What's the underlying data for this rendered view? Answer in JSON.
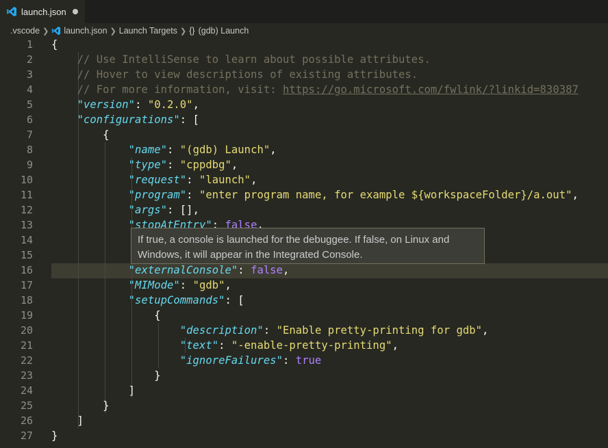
{
  "tab": {
    "label": "launch.json"
  },
  "breadcrumbs": {
    "items": [
      ".vscode",
      "launch.json",
      "Launch Targets",
      "(gdb) Launch"
    ],
    "braces": "{}"
  },
  "gutter": {
    "line_numbers": [
      "1",
      "2",
      "3",
      "4",
      "5",
      "6",
      "7",
      "8",
      "9",
      "10",
      "11",
      "12",
      "13",
      "14",
      "15",
      "16",
      "17",
      "18",
      "19",
      "20",
      "21",
      "22",
      "23",
      "24",
      "25",
      "26",
      "27"
    ]
  },
  "editor": {
    "current_line": 16,
    "lines": {
      "l1": "{",
      "l2": "// Use IntelliSense to learn about possible attributes.",
      "l3": "// Hover to view descriptions of existing attributes.",
      "l4_prefix": "// For more information, visit: ",
      "l4_link": "https://go.microsoft.com/fwlink/?linkid=830387",
      "l5_key": "\"version\"",
      "l5_val": "\"0.2.0\"",
      "l6_key": "\"configurations\"",
      "l6_rest": ": [",
      "l7": "{",
      "l8_key": "\"name\"",
      "l8_val": "\"(gdb) Launch\"",
      "l9_key": "\"type\"",
      "l9_val": "\"cppdbg\"",
      "l10_key": "\"request\"",
      "l10_val": "\"launch\"",
      "l11_key": "\"program\"",
      "l11_val": "\"enter program name, for example ${workspaceFolder}/a.out\"",
      "l12_key": "\"args\"",
      "l12_rest": ": [],",
      "l13_key": "\"stopAtEntry\"",
      "l13_val": "false",
      "l16_key": "\"externalConsole\"",
      "l16_val": "false",
      "l17_key": "\"MIMode\"",
      "l17_val": "\"gdb\"",
      "l18_key": "\"setupCommands\"",
      "l18_rest": ": [",
      "l19": "{",
      "l20_key": "\"description\"",
      "l20_val": "\"Enable pretty-printing for gdb\"",
      "l21_key": "\"text\"",
      "l21_val": "\"-enable-pretty-printing\"",
      "l22_key": "\"ignoreFailures\"",
      "l22_val": "true",
      "l23": "}",
      "l24": "]",
      "l25": "}",
      "l26": "]",
      "l27": "}"
    }
  },
  "hover": {
    "text_line1": "If true, a console is launched for the debuggee. If false, on Linux and",
    "text_line2": "Windows, it will appear in the Integrated Console."
  },
  "colors": {
    "background": "#272822",
    "comment": "#75715e",
    "key": "#66d9ef",
    "string": "#e6db74",
    "boolean": "#ae81ff",
    "icon_blue": "#23a9f2"
  },
  "icons": {
    "file": "vscode-logo-icon",
    "symbol": "braces-icon",
    "separator": "chevron-right-icon",
    "dirty": "unsaved-dot-icon"
  }
}
